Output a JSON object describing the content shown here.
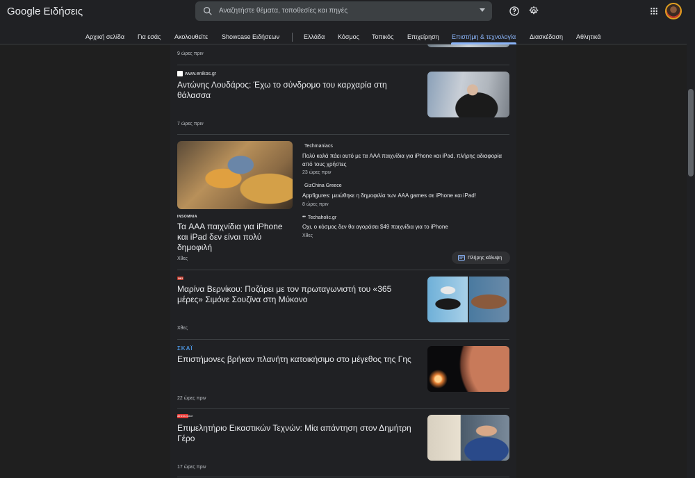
{
  "header": {
    "logo_google": "Google",
    "logo_product": "Ειδήσεις",
    "search_placeholder": "Αναζητήστε θέματα, τοποθεσίες και πηγές"
  },
  "nav": {
    "items": [
      "Αρχική σελίδα",
      "Για εσάς",
      "Ακολουθείτε",
      "Showcase Ειδήσεων",
      "Ελλάδα",
      "Κόσμος",
      "Τοπικός",
      "Επιχείρηση",
      "Επιστήμη & τεχνολογία",
      "Διασκέδαση",
      "Αθλητικά"
    ],
    "active": "Επιστήμη & τεχνολογία"
  },
  "feed": {
    "top_time": "9 ώρες πριν",
    "articles": [
      {
        "source": "www.enikos.gr",
        "title": "Αντώνης Λουδάρος: Έχω το σύνδρομο του καρχαρία στη θάλασσα",
        "time": "7 ώρες πριν"
      },
      {
        "source": "INSOMNIA",
        "title": "Τα AAA παιχνίδια για iPhone και iPad δεν είναι πολύ δημοφιλή",
        "time": "Χθες"
      },
      {
        "source": "OK!",
        "title": "Μαρίνα Βερνίκου: Ποζάρει με τον πρωταγωνιστή του «365 μέρες» Σιμόνε Σουζίνα στη Μύκονο",
        "time": "Χθες"
      },
      {
        "source": "ΣΚΑΪ",
        "title": "Επιστήμονες βρήκαν πλανήτη κατοικήσιμο στο μέγεθος της Γης",
        "time": "22 ώρες πριν"
      },
      {
        "source": "athens voice",
        "title": "Επιμελητήριο Εικαστικών Τεχνών: Μία απάντηση στον Δημήτρη Γέρο",
        "time": "17 ώρες πριν"
      }
    ],
    "cluster": [
      {
        "source": "Techmaniacs",
        "title": "Πολύ καλά πάει αυτό με τα AAA παιχνίδια για iPhone και iPad, πλήρης αδιαφορία από τους χρήστες",
        "time": "23 ώρες πριν"
      },
      {
        "source": "GizChina Greece",
        "title": "Appfigures: μειώθηκε η δημοφιλία των AAA games σε iPhone και iPad!",
        "time": "8 ώρες πριν"
      },
      {
        "source": "Techaholic.gr",
        "title": "Οχι, ο κόσμος δεν θα αγοράσει $49 παιχνίδια για το iPhone",
        "time": "Χθες"
      }
    ],
    "full_coverage": "Πλήρης κάλυψη"
  },
  "icons": [
    "search-icon",
    "chevron-down-icon",
    "help-icon",
    "settings-icon",
    "apps-icon",
    "avatar"
  ],
  "colors": {
    "accent": "#8ab4f8",
    "background": "#202124"
  }
}
